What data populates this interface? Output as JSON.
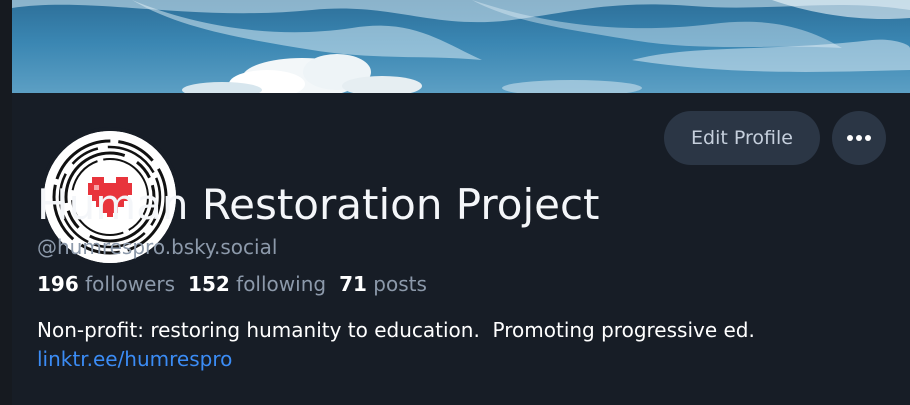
{
  "profile": {
    "display_name": "Human Restoration Project",
    "handle": "@humrespro.bsky.social",
    "bio": "Non-profit: restoring humanity to education.  Promoting progressive ed.",
    "link": "linktr.ee/humrespro"
  },
  "stats": {
    "followers_count": "196",
    "followers_label": "followers",
    "following_count": "152",
    "following_label": "following",
    "posts_count": "71",
    "posts_label": "posts"
  },
  "actions": {
    "edit_profile_label": "Edit Profile",
    "more_icon": "ellipsis-icon"
  },
  "colors": {
    "background": "#171d26",
    "button_bg": "#2b3645",
    "link": "#3b8cf5",
    "muted_text": "#8c99aa",
    "avatar_heart": "#e8343c"
  }
}
